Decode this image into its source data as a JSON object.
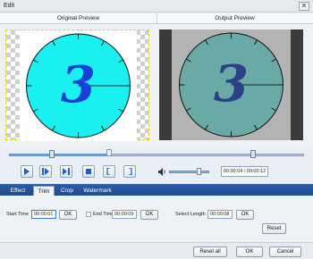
{
  "window": {
    "title": "Edit",
    "close_glyph": "✕"
  },
  "preview": {
    "original_label": "Original Preview",
    "output_label": "Output Preview",
    "original_digit": "3",
    "output_digit": "3",
    "original_face_color": "#19f0f0",
    "output_face_color": "#69aaa6",
    "original_digit_color": "#1a3fd6",
    "output_digit_color": "#2c3f88"
  },
  "timeline": {
    "position_fraction": 0.34
  },
  "player": {
    "buttons": [
      {
        "name": "play-icon"
      },
      {
        "name": "step-forward-icon"
      },
      {
        "name": "next-frame-icon"
      },
      {
        "name": "stop-icon"
      },
      {
        "name": "set-start-icon",
        "glyph": "["
      },
      {
        "name": "set-end-icon",
        "glyph": "]"
      }
    ],
    "volume_fraction": 0.75,
    "time_display": "00:00:04 / 00:00:12"
  },
  "tabs": [
    {
      "label": "Effect"
    },
    {
      "label": "Trim"
    },
    {
      "label": "Crop"
    },
    {
      "label": "Watermark"
    }
  ],
  "trim": {
    "start_time_label": "Start Time",
    "start_time_value": "00:00:01",
    "end_time_label": "End Time",
    "end_time_value": "00:00:09",
    "select_length_label": "Select Length",
    "select_length_value": "00:00:08",
    "ok_label": "OK",
    "reset_label": "Reset"
  },
  "footer": {
    "reset_all_label": "Reset all",
    "ok_label": "OK",
    "cancel_label": "Cancel"
  }
}
